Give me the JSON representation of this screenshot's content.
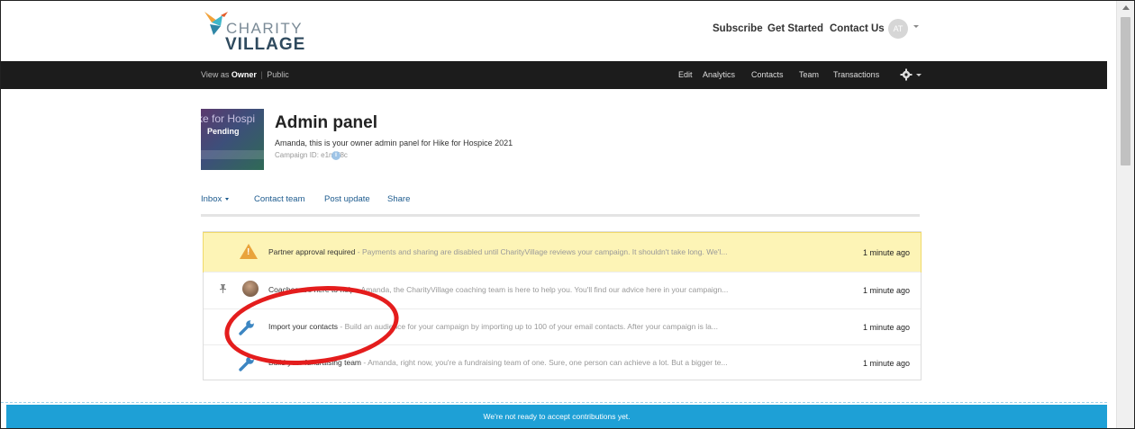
{
  "brand": {
    "line1": "CHARITY",
    "line2": "VILLAGE"
  },
  "top_nav": {
    "subscribe": "Subscribe",
    "get_started": "Get Started",
    "contact_us": "Contact Us",
    "avatar_initials": "AT"
  },
  "owner_bar": {
    "view_as": "View as",
    "owner": "Owner",
    "separator": "|",
    "public": "Public",
    "links": {
      "edit": "Edit",
      "analytics": "Analytics",
      "contacts": "Contacts",
      "team": "Team",
      "transactions": "Transactions"
    }
  },
  "campaign": {
    "thumbnail_text": "ke for Hospi",
    "thumbnail_status": "Pending",
    "title": "Admin panel",
    "subtitle": "Amanda, this is your owner admin panel for Hike for Hospice 2021",
    "campaign_id": "Campaign ID: e1mU8c"
  },
  "tabs": {
    "inbox": "Inbox",
    "contact_team": "Contact team",
    "post_update": "Post update",
    "share": "Share"
  },
  "notifications": [
    {
      "title": "Partner approval required",
      "desc": " - Payments and sharing are disabled until CharityVillage reviews your campaign. It shouldn't take long. We'l...",
      "time": "1 minute ago",
      "icon": "warning-icon"
    },
    {
      "title": "Coaches are here to help",
      "desc": " - Amanda, the CharityVillage coaching team is here to help you. You'll find our advice here in your campaign...",
      "time": "1 minute ago",
      "icon": "coach-avatar"
    },
    {
      "title": "Import your contacts",
      "desc": " - Build an audience for your campaign by importing up to 100 of your email contacts. After your campaign is la...",
      "time": "1 minute ago",
      "icon": "wrench-icon"
    },
    {
      "title": "Build your fundraising team",
      "desc": " - Amanda, right now, you're a fundraising team of one. Sure, one person can achieve a lot. But a bigger te...",
      "time": "1 minute ago",
      "icon": "wrench-icon"
    }
  ],
  "footer_notice": "We're not ready to accept contributions yet.",
  "colors": {
    "accent_blue": "#1ea0d6",
    "warning_bg": "#fdf4b6",
    "dark_bar": "#1c1c1c",
    "annotation_red": "#e41d1d"
  }
}
